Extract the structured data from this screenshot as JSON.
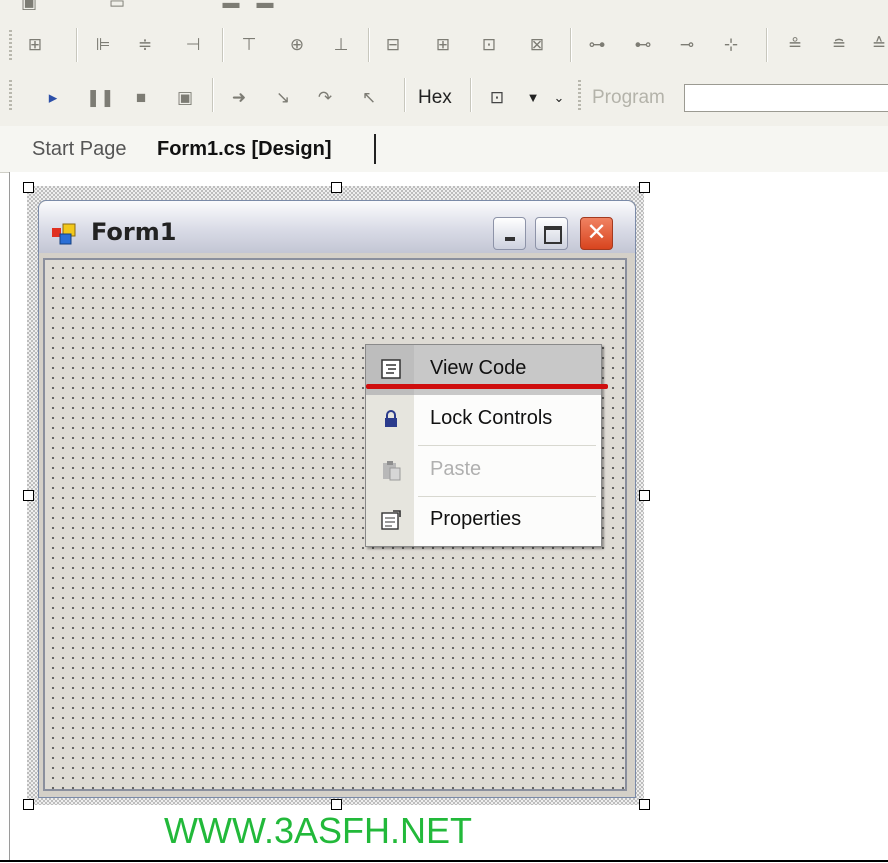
{
  "toolbar_debug": {
    "hex_label": "Hex",
    "program_label": "Program",
    "program_value": ""
  },
  "tabs": [
    {
      "label": "Start Page"
    },
    {
      "label": "Form1.cs [Design]"
    }
  ],
  "form": {
    "title": "Form1"
  },
  "context_menu": {
    "items": [
      {
        "label": "View Code",
        "icon": "view-code-icon",
        "enabled": true
      },
      {
        "label": "Lock Controls",
        "icon": "lock-icon",
        "enabled": true
      },
      {
        "label": "Paste",
        "icon": "paste-icon",
        "enabled": false
      },
      {
        "label": "Properties",
        "icon": "properties-icon",
        "enabled": true
      }
    ]
  },
  "annotation": {
    "underline_color": "#cf0e0e"
  },
  "watermark": {
    "text": "WWW.3ASFH.NET",
    "color": "#22b93a"
  }
}
